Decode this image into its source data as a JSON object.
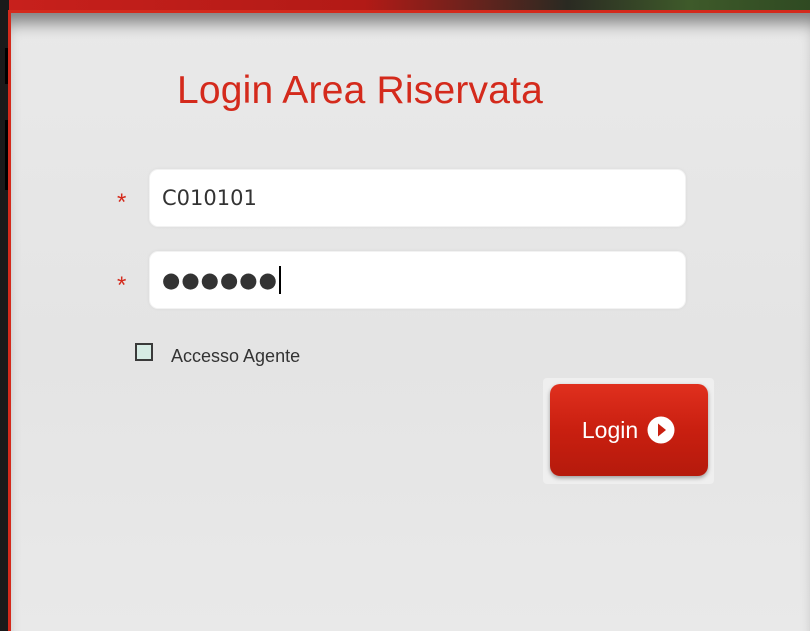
{
  "colors": {
    "accent": "#d42a1c",
    "button_bg": "#c91f10",
    "panel_bg": "#e7e7e7",
    "checkbox_fill": "#d6ebe4"
  },
  "login": {
    "title": "Login Area Riservata",
    "required_marker": "*",
    "username": {
      "value": "C010101"
    },
    "password": {
      "value": "●●●●●●"
    },
    "agent_checkbox": {
      "label": "Accesso Agente",
      "checked": false
    },
    "submit": {
      "label": "Login",
      "icon": "play-circle-icon"
    }
  }
}
